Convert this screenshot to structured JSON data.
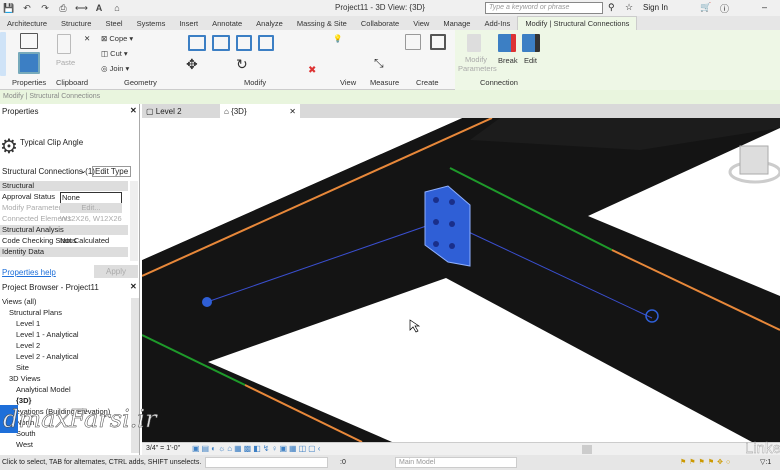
{
  "app": {
    "title": "Project11 - 3D View: {3D}",
    "search_placeholder": "Type a keyword or phrase",
    "sign_in": "Sign In"
  },
  "ribbon_tabs": [
    "Architecture",
    "Structure",
    "Steel",
    "Systems",
    "Insert",
    "Annotate",
    "Analyze",
    "Massing & Site",
    "Collaborate",
    "View",
    "Manage",
    "Add-Ins",
    "Modify | Structural Connections"
  ],
  "ribbon": {
    "properties": "Properties",
    "clipboard": "Clipboard",
    "paste": "Paste",
    "geometry": "Geometry",
    "cope": "Cope",
    "cut": "Cut",
    "join": "Join",
    "modify": "Modify",
    "view": "View",
    "measure": "Measure",
    "create": "Create",
    "modify_parameters": "Modify Parameters",
    "break": "Break",
    "edit": "Edit",
    "connection": "Connection"
  },
  "context_bar": "Modify | Structural Connections",
  "properties": {
    "header": "Properties",
    "type_name": "Typical Clip Angle",
    "selector": "Structural Connections (1)",
    "edit_type": "Edit Type",
    "rows": [
      {
        "kind": "group",
        "label": "Structural"
      },
      {
        "kind": "row",
        "label": "Approval Status",
        "value": "None"
      },
      {
        "kind": "row",
        "label": "Modify Parameters",
        "value": "Edit..."
      },
      {
        "kind": "row",
        "label": "Connected Elements",
        "value": "W12X26, W12X26"
      },
      {
        "kind": "group",
        "label": "Structural Analysis"
      },
      {
        "kind": "row",
        "label": "Code Checking Status",
        "value": "Not Calculated"
      },
      {
        "kind": "group",
        "label": "Identity Data"
      }
    ],
    "help": "Properties help",
    "apply": "Apply"
  },
  "browser": {
    "header": "Project Browser - Project11",
    "items": [
      {
        "label": "Views (all)",
        "level": 0
      },
      {
        "label": "Structural Plans",
        "level": 1
      },
      {
        "label": "Level 1",
        "level": 2
      },
      {
        "label": "Level 1 - Analytical",
        "level": 2
      },
      {
        "label": "Level 2",
        "level": 2
      },
      {
        "label": "Level 2 - Analytical",
        "level": 2
      },
      {
        "label": "Site",
        "level": 2
      },
      {
        "label": "3D Views",
        "level": 1
      },
      {
        "label": "Analytical Model",
        "level": 2
      },
      {
        "label": "{3D}",
        "level": 2,
        "bold": true
      },
      {
        "label": "Elevations (Building Elevation)",
        "level": 1
      },
      {
        "label": "North",
        "level": 2
      },
      {
        "label": "South",
        "level": 2
      },
      {
        "label": "West",
        "level": 2
      }
    ]
  },
  "view_tabs": [
    {
      "label": "Level 2",
      "active": false
    },
    {
      "label": "{3D}",
      "active": true
    }
  ],
  "view_scale": "3/4\" = 1'-0\"",
  "status": {
    "hint": "Click to select, TAB for alternates, CTRL adds, SHIFT unselects.",
    "count": ":0",
    "model": "Main Model",
    "filter": ":1"
  },
  "watermark": "dmaxFarsi.ir",
  "watermark2": "Linked",
  "colors": {
    "accent": "#1e6fd9",
    "orange_line": "#e8883a",
    "green_line": "#1e9a2a",
    "connection": "#2f5fd6"
  }
}
